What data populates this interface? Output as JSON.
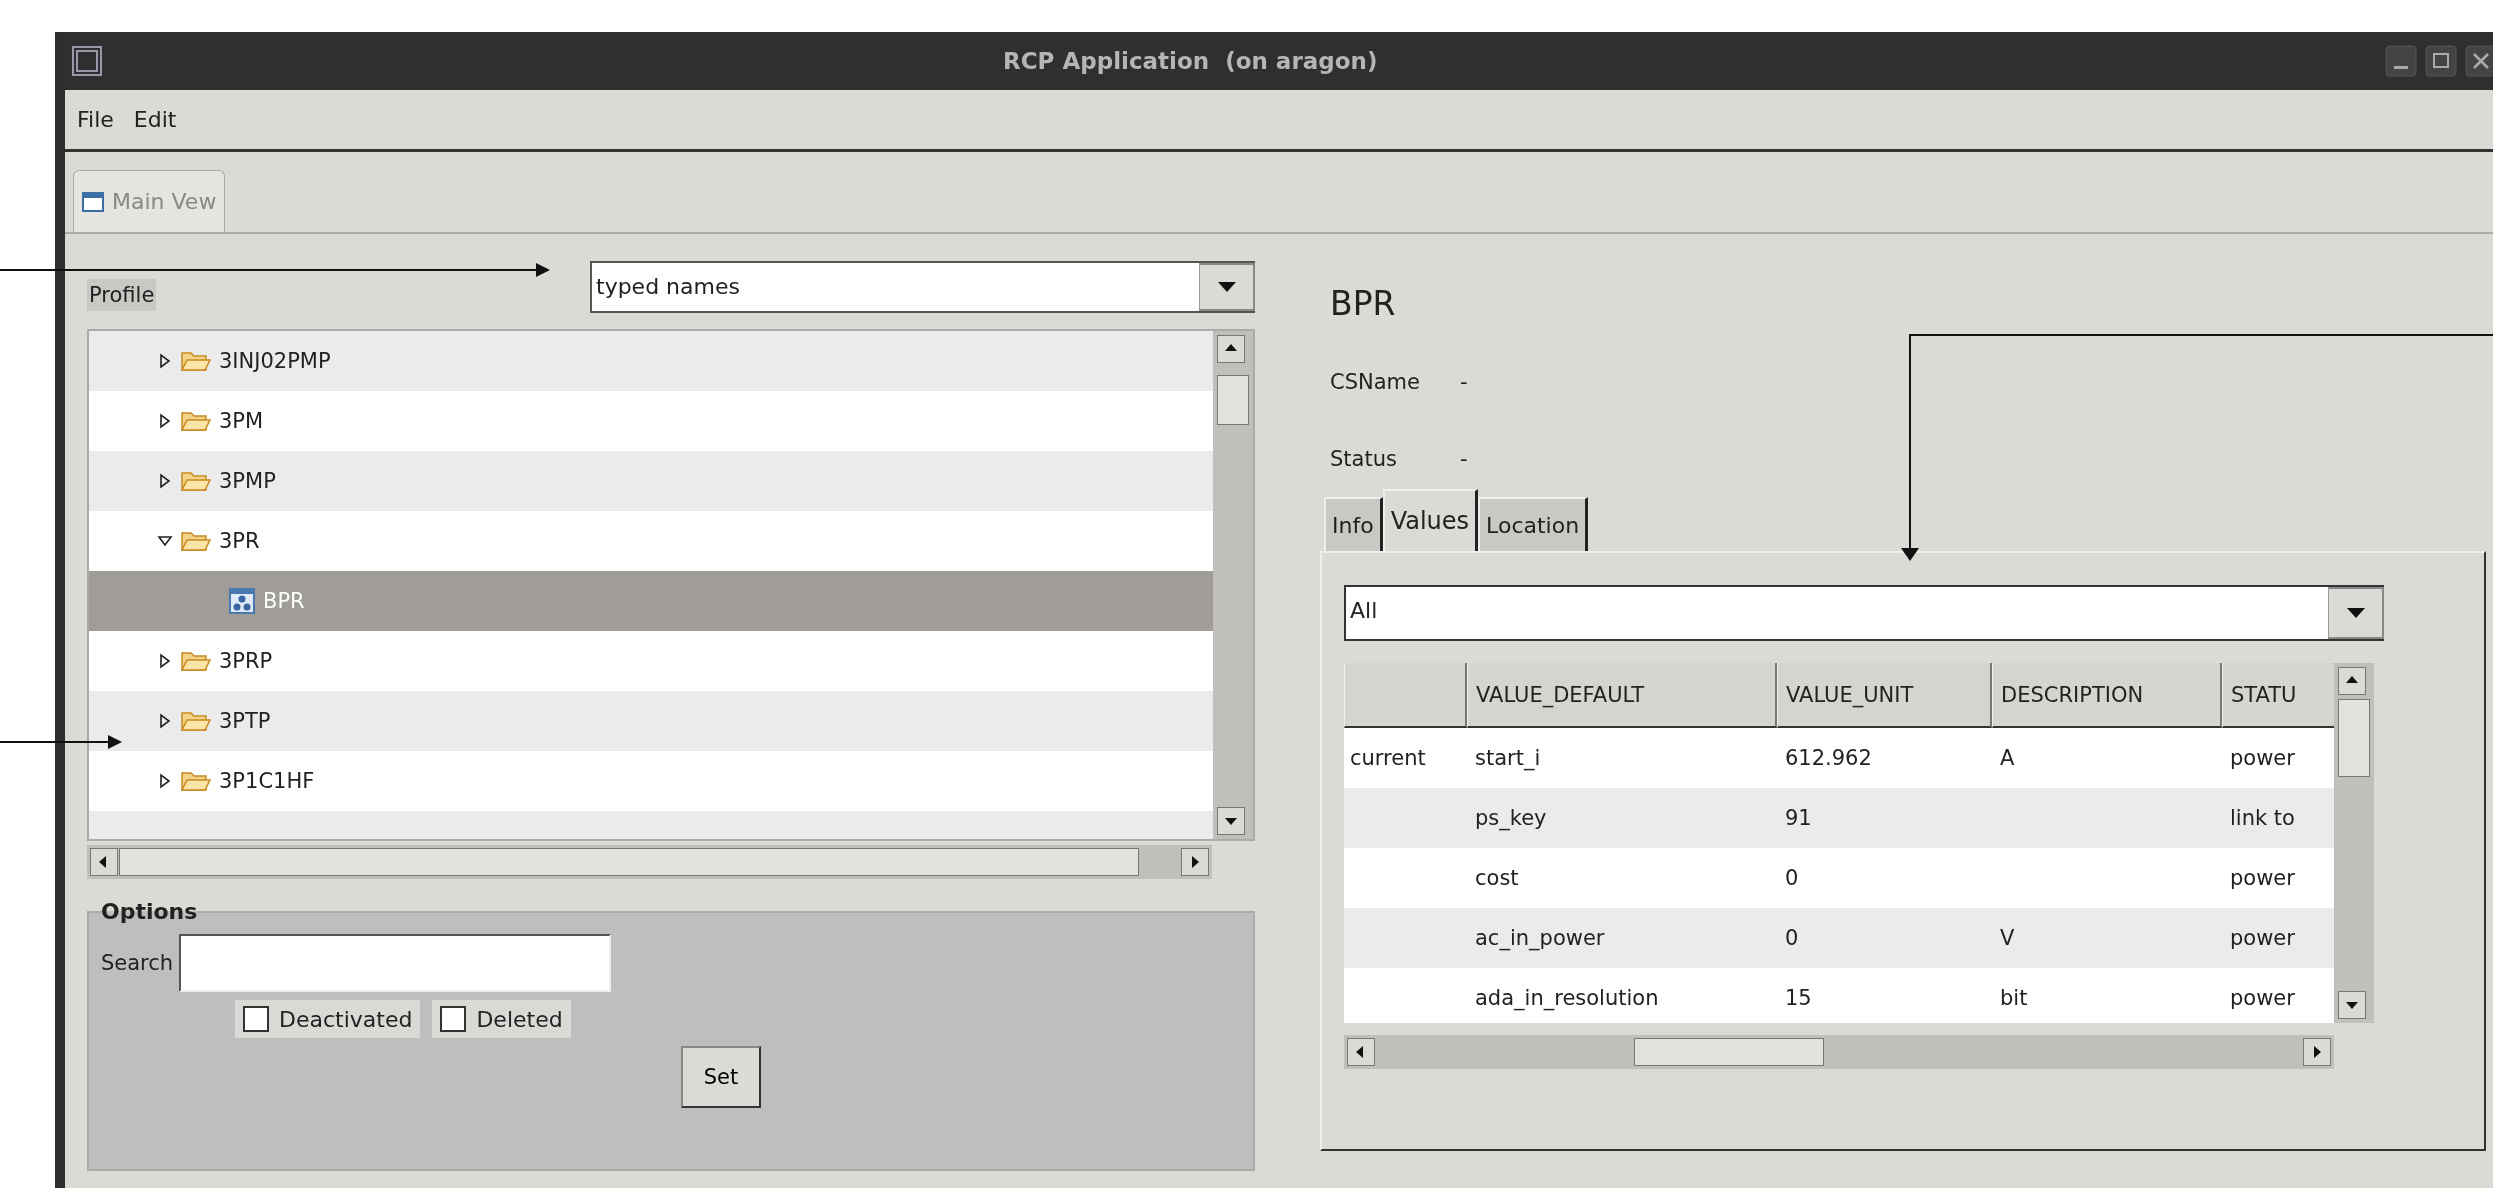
{
  "window": {
    "title": "RCP Application  (on aragon)"
  },
  "menu": [
    "File",
    "Edit"
  ],
  "view_tab": {
    "label": "Main Vew",
    "selected": true
  },
  "profile": {
    "label": "Profile",
    "combo_value": "typed names"
  },
  "tree": [
    {
      "kind": "folder",
      "label": "3INJ02PMP",
      "expanded": false,
      "selected": false
    },
    {
      "kind": "folder",
      "label": "3PM",
      "expanded": false,
      "selected": false
    },
    {
      "kind": "folder",
      "label": "3PMP",
      "expanded": false,
      "selected": false
    },
    {
      "kind": "folder",
      "label": "3PR",
      "expanded": true,
      "selected": false,
      "children": [
        {
          "kind": "object",
          "label": "BPR",
          "selected": true
        }
      ]
    },
    {
      "kind": "folder",
      "label": "3PRP",
      "expanded": false,
      "selected": false
    },
    {
      "kind": "folder",
      "label": "3PTP",
      "expanded": false,
      "selected": false
    },
    {
      "kind": "folder",
      "label": "3P1C1HF",
      "expanded": false,
      "selected": false
    }
  ],
  "options": {
    "title": "Options",
    "search_label": "Search",
    "checkboxes": [
      {
        "label": "Deactivated",
        "checked": false
      },
      {
        "label": "Deleted",
        "checked": false
      }
    ],
    "button": "Set"
  },
  "detail": {
    "heading": "BPR",
    "fields": [
      {
        "label": "CSName",
        "value": "-"
      },
      {
        "label": "Status",
        "value": "-"
      }
    ],
    "tabs": [
      {
        "label": "Info",
        "selected": false
      },
      {
        "label": "Values",
        "selected": true
      },
      {
        "label": "Location",
        "selected": false
      }
    ],
    "filter_value": "All",
    "table": {
      "columns": [
        "",
        "VALUE_DEFAULT",
        "VALUE_UNIT",
        "DESCRIPTION",
        "STATU"
      ],
      "rows": [
        [
          "current",
          "start_i",
          "612.962",
          "A",
          "power"
        ],
        [
          "",
          "ps_key",
          "91",
          "",
          "link to"
        ],
        [
          "",
          "cost",
          "0",
          "",
          "power"
        ],
        [
          "",
          "ac_in_power",
          "0",
          "V",
          "power"
        ],
        [
          "",
          "ada_in_resolution",
          "15",
          "bit",
          "power"
        ]
      ]
    }
  }
}
